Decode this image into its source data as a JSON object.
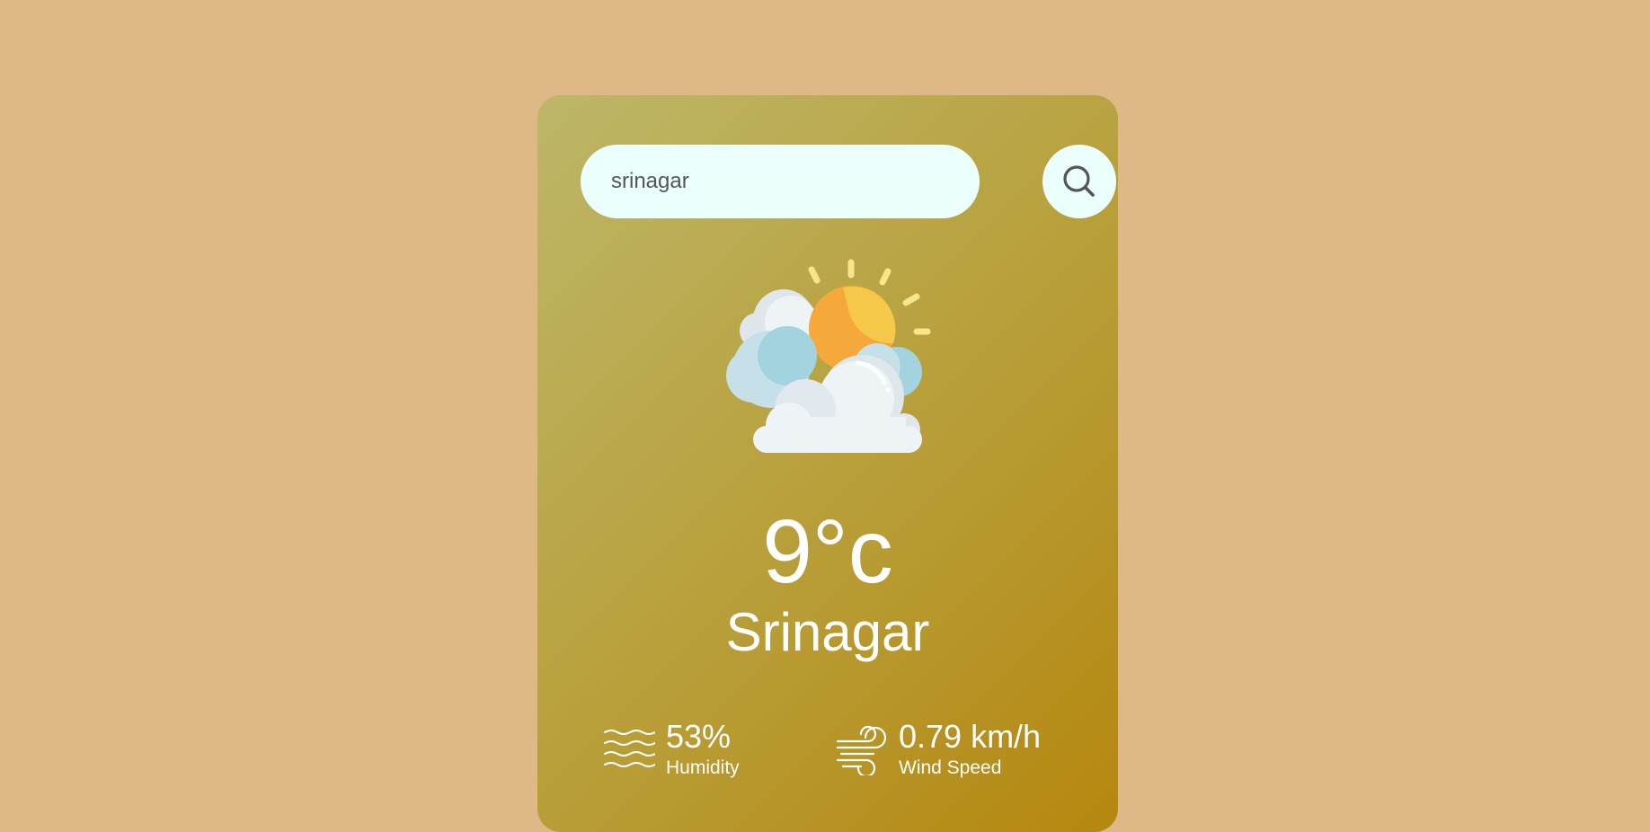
{
  "search": {
    "value": "srinagar",
    "placeholder": "",
    "button_icon": "search-icon"
  },
  "weather": {
    "icon": "partly-cloudy-icon",
    "temperature": "9°c",
    "city": "Srinagar"
  },
  "details": {
    "humidity": {
      "value": "53%",
      "label": "Humidity",
      "icon": "humidity-icon"
    },
    "wind": {
      "value": "0.79 km/h",
      "label": "Wind Speed",
      "icon": "wind-icon"
    }
  },
  "colors": {
    "background": "#dfb887",
    "card_gradient_start": "#bdb769",
    "card_gradient_end": "#b5870f",
    "input_bg": "#ebfffc",
    "text": "#ffffff"
  }
}
